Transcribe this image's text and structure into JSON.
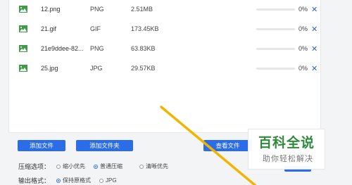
{
  "files": [
    {
      "name": "12.png",
      "type": "PNG",
      "size": "2.51MB",
      "progress": 0,
      "percent_label": "0%",
      "remove_label": "✕"
    },
    {
      "name": "21.gif",
      "type": "GIF",
      "size": "173.45KB",
      "progress": 0,
      "percent_label": "0%",
      "remove_label": "✕"
    },
    {
      "name": "21e9ddee-82...",
      "type": "PNG",
      "size": "63.83KB",
      "progress": 0,
      "percent_label": "0%",
      "remove_label": "✕"
    },
    {
      "name": "25.jpg",
      "type": "JPG",
      "size": "29.57KB",
      "progress": 0,
      "percent_label": "0%",
      "remove_label": "✕"
    }
  ],
  "toolbar": {
    "add_file_label": "添加文件",
    "add_folder_label": "添加文件夹",
    "view_file_label": "查看文件"
  },
  "options": {
    "compress_label": "压缩选项：",
    "compress_choices": [
      {
        "label": "缩小优先",
        "selected": false
      },
      {
        "label": "普通压缩",
        "selected": true
      },
      {
        "label": "清晰优先",
        "selected": false
      }
    ],
    "output_label": "输出格式：",
    "output_choices": [
      {
        "label": "保持原格式",
        "selected": true
      },
      {
        "label": "JPG",
        "selected": false
      }
    ]
  },
  "watermark": {
    "title": "百科全说",
    "subtitle": "助你轻松解决"
  },
  "colors": {
    "accent": "#2b6de8",
    "arrow": "#f3b400",
    "watermark_green": "#2e8b3a",
    "file_icon": "#3f9a4a"
  },
  "icons": {
    "file": "image-file-icon",
    "remove": "close-icon"
  }
}
